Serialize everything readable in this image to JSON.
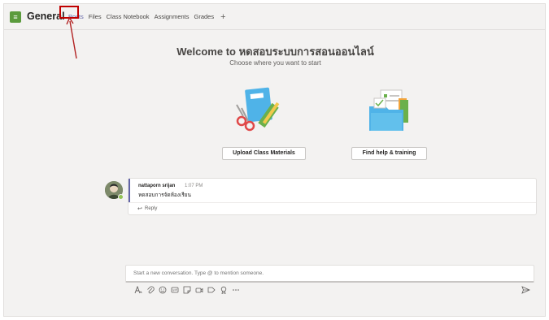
{
  "header": {
    "team_icon_label": "≡",
    "channel_name": "General",
    "tabs": [
      {
        "label": "Posts"
      },
      {
        "label": "Files"
      },
      {
        "label": "Class Notebook"
      },
      {
        "label": "Assignments"
      },
      {
        "label": "Grades"
      }
    ],
    "add_tab_label": "+"
  },
  "welcome": {
    "title": "Welcome to หดสอบระบบการสอนออนไลน์",
    "subtitle": "Choose where you want to start",
    "upload_button": "Upload Class Materials",
    "help_button": "Find help & training"
  },
  "post": {
    "author": "nattaporn srijan",
    "time": "1:07 PM",
    "message": "หดสอบการจัดห้องเรียน",
    "reply_label": "Reply"
  },
  "compose": {
    "placeholder": "Start a new conversation. Type @ to mention someone."
  },
  "toolbar": {
    "icons": [
      "format-icon",
      "attach-icon",
      "emoji-icon",
      "gif-icon",
      "sticker-icon",
      "meet-now-icon",
      "stream-icon",
      "praise-icon",
      "more-options-icon"
    ]
  },
  "colors": {
    "accent": "#6264a7",
    "team_icon": "#5b9b3d",
    "highlight": "#c00000",
    "background": "#f3f2f1"
  }
}
